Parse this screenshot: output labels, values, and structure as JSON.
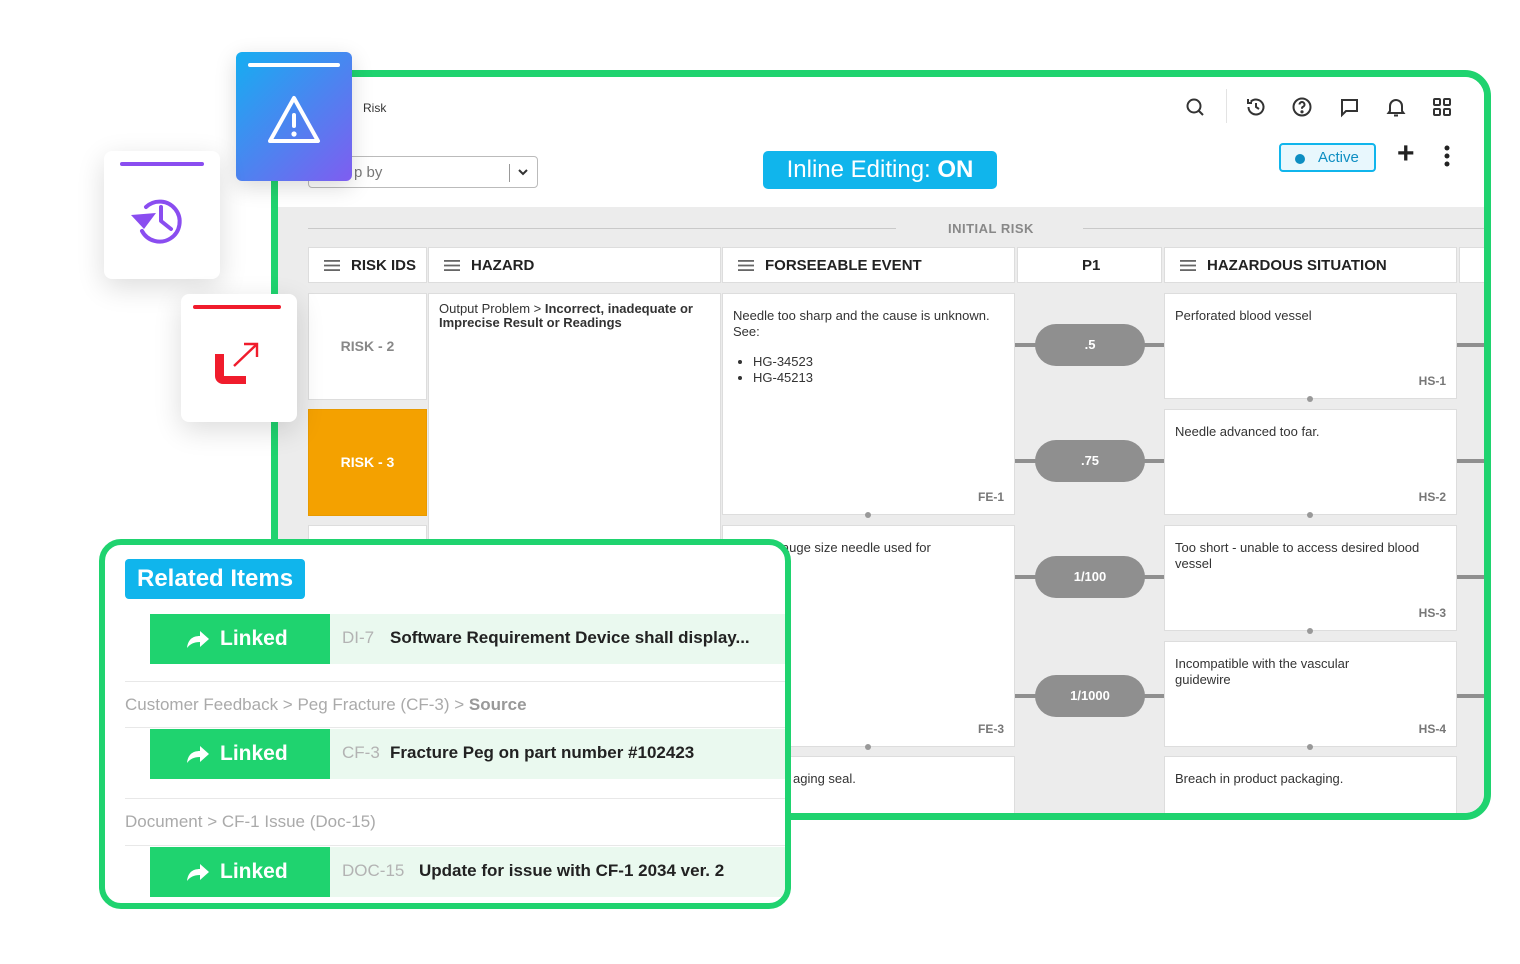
{
  "header": {
    "crumb": "Risk",
    "group_by_placeholder": "p by",
    "inline_editing_label": "Inline Editing:",
    "inline_editing_state": "ON",
    "status": "Active",
    "toolbar_icons": [
      "search-icon",
      "history-icon",
      "help-icon",
      "comment-icon",
      "bell-icon",
      "apps-grid-icon"
    ]
  },
  "grid": {
    "section_title": "INITIAL RISK",
    "columns": [
      "RISK IDS",
      "HAZARD",
      "FORSEEABLE EVENT",
      "P1",
      "HAZARDOUS SITUATION"
    ],
    "risks": [
      "RISK - 2",
      "RISK - 3"
    ],
    "hazard": {
      "prefix": "Output Problem >",
      "detail": "Incorrect, inadequate or Imprecise Result or Readings"
    },
    "events": [
      {
        "text": "Needle too sharp and the cause is unknown. See:",
        "bullets": [
          "HG-34523",
          "HG-45213"
        ],
        "code": "FE-1"
      },
      {
        "text": "Wrong gauge size needle used for",
        "code": "FE-3"
      },
      {
        "text": "aging seal."
      }
    ],
    "probabilities": [
      ".5",
      ".75",
      "1/100",
      "1/1000"
    ],
    "situations": [
      {
        "text": "Perforated blood vessel",
        "code": "HS-1"
      },
      {
        "text": "Needle advanced too far.",
        "code": "HS-2"
      },
      {
        "text": "Too short - unable to access desired blood vessel",
        "code": "HS-3"
      },
      {
        "text": "Incompatible with the vascular guidewire",
        "code": "HS-4"
      },
      {
        "text": "Breach in product packaging."
      }
    ]
  },
  "related": {
    "title": "Related Items",
    "linked_label": "Linked",
    "items": [
      {
        "id": "DI-7",
        "text": "Software Requirement Device shall display..."
      },
      {
        "path": "Customer Feedback > Peg Fracture (CF-3) >",
        "path_end": "Source",
        "id": "CF-3",
        "text": "Fracture Peg on part number #102423"
      },
      {
        "path": "Document > CF-1 Issue (Doc-15)",
        "id": "DOC-15",
        "text": "Update for issue with CF-1 2034 ver. 2"
      }
    ]
  },
  "colors": {
    "green": "#1fd36f",
    "blue": "#10b5ec",
    "orange": "#f4a100",
    "purple": "#8a4df0",
    "red": "#f01c2c"
  }
}
